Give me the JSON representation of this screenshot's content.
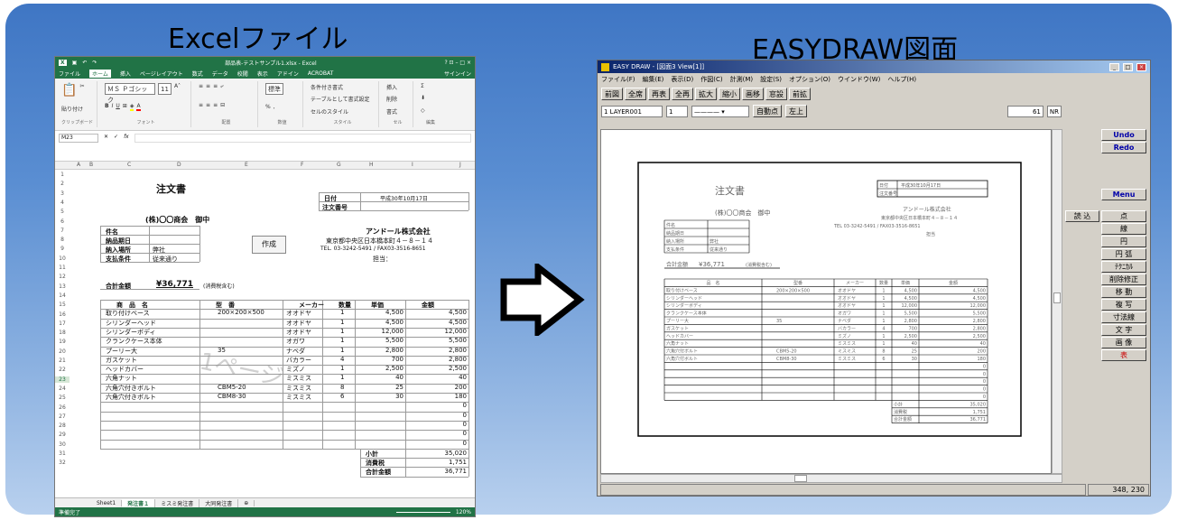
{
  "headings": {
    "excel": "Excelファイル",
    "easydraw": "EASYDRAW図面"
  },
  "excel": {
    "title": "部品表-テストサンプル1.xlsx - Excel",
    "window_controls": "?  ⊡  –  □  ×",
    "menu": [
      "ファイル",
      "ホーム",
      "挿入",
      "ページレイアウト",
      "数式",
      "データ",
      "校閲",
      "表示",
      "アドイン",
      "ACROBAT"
    ],
    "signin": "サインイン",
    "ribbon": {
      "clipboard": "クリップボード",
      "paste": "貼り付け",
      "font_name": "ＭＳ Ｐゴシック",
      "font_size": "11",
      "font_group": "フォント",
      "align_group": "配置",
      "number_group": "数値",
      "number_format": "標準",
      "style_group": "スタイル",
      "style1": "条件付き書式",
      "style2": "テーブルとして書式設定",
      "style3": "セルのスタイル",
      "cell_group": "セル",
      "cell1": "挿入",
      "cell2": "削除",
      "cell3": "書式",
      "edit_group": "編集"
    },
    "namebox": "M23",
    "fx": "fx",
    "columns": [
      "A",
      "B",
      "C",
      "D",
      "E",
      "F",
      "G",
      "H",
      "I",
      "J"
    ],
    "rows": [
      "1",
      "2",
      "3",
      "4",
      "5",
      "6",
      "7",
      "8",
      "9",
      "10",
      "11",
      "12",
      "13",
      "14",
      "15",
      "16",
      "17",
      "18",
      "19",
      "20",
      "21",
      "22",
      "23",
      "24",
      "25",
      "26",
      "27",
      "28",
      "29",
      "30",
      "31",
      "32"
    ],
    "doc_title": "注文書",
    "date_label": "日付",
    "date_value": "平成30年10月17日",
    "order_no_label": "注文番号",
    "customer": "(株)〇〇商会　御中",
    "company": "アンドール株式会社",
    "address": "東京都中央区日本橋本町４－８－１４",
    "tel": "TEL. 03-3242-5491 / FAX03-3516-8651",
    "contact": "担当：",
    "f_item": "件名",
    "f_due": "納品期日",
    "f_place": "納入場所",
    "f_place_val": "弊社",
    "f_terms": "支払条件",
    "f_terms_val": "従来通り",
    "create_btn": "作成",
    "total_label": "合計金額",
    "total_value": "¥36,771",
    "total_note": "(消費税含む)",
    "table_headers": [
      "商　品　名",
      "型　番",
      "メーカー",
      "数量",
      "単価",
      "金額"
    ],
    "table_rows": [
      [
        "取り付けベース",
        "200×200×500",
        "オオドヤ",
        "1",
        "4,500",
        "4,500"
      ],
      [
        "シリンダーヘッド",
        "",
        "オオドヤ",
        "1",
        "4,500",
        "4,500"
      ],
      [
        "シリンダーボディ",
        "",
        "オオドヤ",
        "1",
        "12,000",
        "12,000"
      ],
      [
        "クランクケース本体",
        "",
        "オガワ",
        "1",
        "5,500",
        "5,500"
      ],
      [
        "プーリー大",
        "35",
        "ナベダ",
        "1",
        "2,800",
        "2,800"
      ],
      [
        "ガスケット",
        "",
        "バカラー",
        "4",
        "700",
        "2,800"
      ],
      [
        "ヘッドカバー",
        "",
        "ミズノ",
        "1",
        "2,500",
        "2,500"
      ],
      [
        "六角ナット",
        "",
        "ミスミス",
        "1",
        "40",
        "40"
      ],
      [
        "六角穴付きボルト",
        "CBM5-20",
        "ミスミス",
        "8",
        "25",
        "200"
      ],
      [
        "六角穴付きボルト",
        "CBM8-30",
        "ミスミス",
        "6",
        "30",
        "180"
      ]
    ],
    "zero": "0",
    "subtotal_label": "小計",
    "subtotal": "35,020",
    "tax_label": "消費税",
    "tax": "1,751",
    "grand_label": "合計金額",
    "grand": "36,771",
    "watermark": "1ページ",
    "tabs": [
      "Sheet1",
      "発注書１",
      "ミスミ発注書",
      "大同発注書"
    ],
    "tab_add": "⊕",
    "status": "準備完了",
    "zoom": "120%"
  },
  "easydraw": {
    "title": "EASY DRAW - [図面3 View[1]]",
    "menu": [
      "ファイル(F)",
      "編集(E)",
      "表示(D)",
      "作図(C)",
      "計測(M)",
      "設定(S)",
      "オプション(O)",
      "ウインドウ(W)",
      "ヘルプ(H)"
    ],
    "tools": [
      "前図",
      "全席",
      "再表",
      "全再",
      "拡大",
      "縮小",
      "画移",
      "窓設",
      "前拡"
    ],
    "layer": "1  LAYER001",
    "layer2": "1",
    "auto_point": "自動点",
    "left_top": "左上",
    "coord": "61",
    "nr": "NR",
    "side_top": [
      "Undo",
      "Redo",
      "Menu"
    ],
    "read": "読 込",
    "side": [
      "点",
      "線",
      "円",
      "円 弧",
      "ﾃｸﾆｶﾙ",
      "削除修正",
      "移 動",
      "複 写",
      "寸法線",
      "文 字",
      "画 像",
      "表"
    ],
    "status_xy": "348,    230",
    "drawing": {
      "title": "注文書",
      "date_label": "日付",
      "date_value": "平成30年10月17日",
      "order_no_label": "注文番号",
      "customer": "(株)〇〇商会　御中",
      "company": "アンドール株式会社",
      "address": "東京都中央区日本橋本町４－８－１４",
      "tel": "TEL 03-3242-5491 / FAX03-3516-8651",
      "contact": "担当",
      "f_item": "件名",
      "f_due": "納品期日",
      "f_place": "納入場所",
      "f_place_val": "弊社",
      "f_terms": "支払条件",
      "f_terms_val": "従来通り",
      "total_label": "合計金額",
      "total_value": "¥36,771",
      "total_note": "(消費税含む)",
      "table_headers": [
        "品　名",
        "型番",
        "メーカー",
        "数量",
        "単価",
        "金額"
      ],
      "table_rows": [
        [
          "取り付けベース",
          "200×200×500",
          "オオドヤ",
          "1",
          "4,500",
          "4,500"
        ],
        [
          "シリンダーヘッド",
          "",
          "オオドヤ",
          "1",
          "4,500",
          "4,500"
        ],
        [
          "シリンダーボディ",
          "",
          "オオドヤ",
          "1",
          "12,000",
          "12,000"
        ],
        [
          "クランクケース本体",
          "",
          "オガワ",
          "1",
          "5,500",
          "5,500"
        ],
        [
          "プーリー大",
          "35",
          "ナベダ",
          "1",
          "2,800",
          "2,800"
        ],
        [
          "ガスケット",
          "",
          "バカラー",
          "4",
          "700",
          "2,800"
        ],
        [
          "ヘッドカバー",
          "",
          "ミズノ",
          "1",
          "2,500",
          "2,500"
        ],
        [
          "六角ナット",
          "",
          "ミスミス",
          "1",
          "40",
          "40"
        ],
        [
          "六角穴付ボルト",
          "CBM5-20",
          "ミスミス",
          "8",
          "25",
          "200"
        ],
        [
          "六角穴付ボルト",
          "CBM8-30",
          "ミスミス",
          "6",
          "30",
          "180"
        ]
      ],
      "zero": "0",
      "subtotal_label": "小計",
      "subtotal": "35,020",
      "tax_label": "消費税",
      "tax": "1,751",
      "grand_label": "合計金額",
      "grand": "36,771"
    }
  }
}
